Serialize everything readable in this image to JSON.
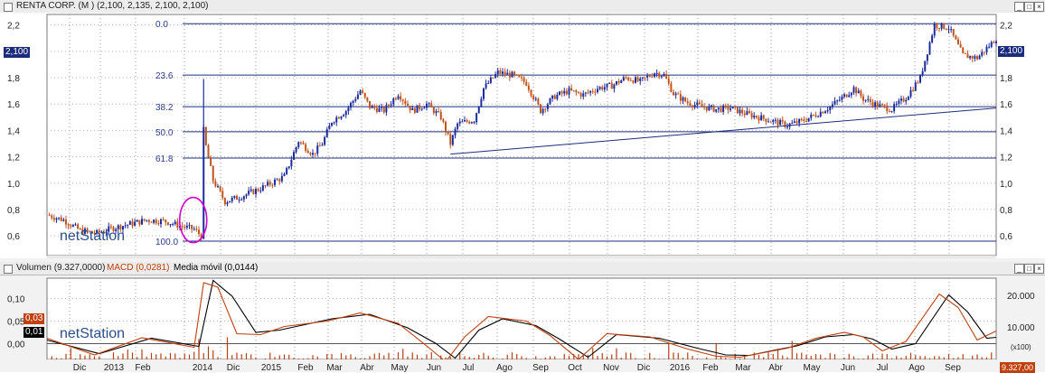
{
  "top_panel": {
    "title": "RENTA CORP. (M ) (2,100, 2,135, 2,100, 2,100)",
    "price_tag": "2,100",
    "watermark": "netStation"
  },
  "bottom_panel": {
    "title_volume": "Volumen (9.327,0000)",
    "title_macd": "MACD (0,0281)",
    "title_ma": "Media móvil (0,0144)",
    "tag_macd": "0,03",
    "tag_ma": "0,01",
    "right_tag": "9.327,00",
    "right_small": "(x100)",
    "watermark": "netStation"
  },
  "buttons": {
    "min": "_",
    "max": "□",
    "close": "×"
  },
  "colors": {
    "up": "#1c2c9c",
    "down": "#c0541c",
    "fib": "#1c2c7c",
    "ellipse": "#d000d0",
    "macd": "#c0400c",
    "signal": "#000000",
    "volume": "#b84010"
  },
  "chart_data": [
    {
      "type": "candlestick",
      "title": "RENTA CORP. (M ) (2,100, 2,135, 2,100, 2,100)",
      "x_labels": [
        "Dic",
        "2013",
        "Feb",
        "2014",
        "Dic",
        "2015",
        "Feb",
        "Mar",
        "Abr",
        "May",
        "Jun",
        "Jul",
        "Ago",
        "Sep",
        "Oct",
        "Nov",
        "Dic",
        "2016",
        "Feb",
        "Mar",
        "Abr",
        "May",
        "Jun",
        "Jul",
        "Ago",
        "Sep"
      ],
      "y_ticks": [
        "0,6",
        "0,8",
        "1,0",
        "1,2",
        "1,4",
        "1,6",
        "1,8",
        "2,0",
        "2,2"
      ],
      "ylim": [
        0.45,
        2.28
      ],
      "last_value": 2.1,
      "fibonacci": [
        {
          "label": "0.0",
          "value": 2.21
        },
        {
          "label": "23.6",
          "value": 1.82
        },
        {
          "label": "38.2",
          "value": 1.58
        },
        {
          "label": "50.0",
          "value": 1.39
        },
        {
          "label": "61.8",
          "value": 1.19
        },
        {
          "label": "100.0",
          "value": 0.56
        }
      ],
      "price_path": [
        [
          0,
          0.76
        ],
        [
          7,
          0.72
        ],
        [
          14,
          0.64
        ],
        [
          21,
          0.62
        ],
        [
          28,
          0.66
        ],
        [
          35,
          0.69
        ],
        [
          42,
          0.72
        ],
        [
          50,
          0.71
        ],
        [
          57,
          0.67
        ],
        [
          62,
          0.65
        ],
        [
          65,
          0.6
        ],
        [
          66,
          1.4
        ],
        [
          67,
          1.28
        ],
        [
          70,
          1.02
        ],
        [
          75,
          0.86
        ],
        [
          82,
          0.9
        ],
        [
          90,
          0.96
        ],
        [
          100,
          1.05
        ],
        [
          106,
          1.32
        ],
        [
          112,
          1.22
        ],
        [
          116,
          1.3
        ],
        [
          120,
          1.47
        ],
        [
          126,
          1.55
        ],
        [
          132,
          1.7
        ],
        [
          136,
          1.58
        ],
        [
          142,
          1.55
        ],
        [
          148,
          1.68
        ],
        [
          154,
          1.55
        ],
        [
          160,
          1.6
        ],
        [
          166,
          1.5
        ],
        [
          170,
          1.3
        ],
        [
          173,
          1.45
        ],
        [
          180,
          1.48
        ],
        [
          184,
          1.72
        ],
        [
          190,
          1.84
        ],
        [
          196,
          1.82
        ],
        [
          202,
          1.76
        ],
        [
          208,
          1.55
        ],
        [
          214,
          1.66
        ],
        [
          220,
          1.7
        ],
        [
          226,
          1.67
        ],
        [
          232,
          1.72
        ],
        [
          238,
          1.74
        ],
        [
          244,
          1.8
        ],
        [
          250,
          1.77
        ],
        [
          256,
          1.84
        ],
        [
          260,
          1.82
        ],
        [
          264,
          1.68
        ],
        [
          270,
          1.61
        ],
        [
          276,
          1.58
        ],
        [
          282,
          1.56
        ],
        [
          288,
          1.57
        ],
        [
          294,
          1.53
        ],
        [
          300,
          1.5
        ],
        [
          306,
          1.47
        ],
        [
          312,
          1.44
        ],
        [
          318,
          1.47
        ],
        [
          324,
          1.52
        ],
        [
          330,
          1.58
        ],
        [
          336,
          1.66
        ],
        [
          340,
          1.72
        ],
        [
          344,
          1.64
        ],
        [
          350,
          1.59
        ],
        [
          356,
          1.56
        ],
        [
          362,
          1.65
        ],
        [
          368,
          1.8
        ],
        [
          374,
          2.2
        ],
        [
          380,
          2.18
        ],
        [
          386,
          1.97
        ],
        [
          392,
          1.95
        ],
        [
          398,
          2.06
        ],
        [
          400,
          2.1
        ]
      ],
      "trendline": [
        [
          170,
          1.22
        ],
        [
          400,
          1.57
        ]
      ],
      "annotation_ellipse_x": 62
    },
    {
      "type": "macd",
      "series": [
        {
          "name": "MACD (0,0281)",
          "points": [
            [
              0,
              0.012
            ],
            [
              20,
              -0.025
            ],
            [
              40,
              0.013
            ],
            [
              62,
              -0.008
            ],
            [
              66,
              0.135
            ],
            [
              72,
              0.125
            ],
            [
              80,
              0.022
            ],
            [
              90,
              0.02
            ],
            [
              100,
              0.038
            ],
            [
              118,
              0.05
            ],
            [
              132,
              0.068
            ],
            [
              148,
              0.045
            ],
            [
              160,
              -0.005
            ],
            [
              168,
              -0.04
            ],
            [
              176,
              0.015
            ],
            [
              186,
              0.06
            ],
            [
              202,
              0.05
            ],
            [
              212,
              0.018
            ],
            [
              224,
              -0.035
            ],
            [
              236,
              0.022
            ],
            [
              254,
              0.015
            ],
            [
              270,
              -0.012
            ],
            [
              282,
              -0.028
            ],
            [
              292,
              -0.03
            ],
            [
              302,
              -0.02
            ],
            [
              312,
              -0.01
            ],
            [
              324,
              0.012
            ],
            [
              336,
              0.025
            ],
            [
              344,
              0.015
            ],
            [
              352,
              -0.016
            ],
            [
              362,
              0.005
            ],
            [
              376,
              0.11
            ],
            [
              384,
              0.08
            ],
            [
              392,
              0.008
            ],
            [
              400,
              0.028
            ]
          ]
        },
        {
          "name": "Media móvil (0,0144)",
          "points": [
            [
              0,
              0.008
            ],
            [
              22,
              -0.022
            ],
            [
              44,
              0.012
            ],
            [
              64,
              -0.006
            ],
            [
              70,
              0.14
            ],
            [
              78,
              0.105
            ],
            [
              88,
              0.025
            ],
            [
              98,
              0.03
            ],
            [
              120,
              0.055
            ],
            [
              136,
              0.065
            ],
            [
              152,
              0.035
            ],
            [
              164,
              0.0
            ],
            [
              172,
              -0.032
            ],
            [
              182,
              0.03
            ],
            [
              192,
              0.055
            ],
            [
              206,
              0.04
            ],
            [
              216,
              0.01
            ],
            [
              228,
              -0.03
            ],
            [
              240,
              0.02
            ],
            [
              258,
              0.012
            ],
            [
              274,
              -0.01
            ],
            [
              286,
              -0.025
            ],
            [
              296,
              -0.026
            ],
            [
              306,
              -0.015
            ],
            [
              316,
              -0.005
            ],
            [
              328,
              0.015
            ],
            [
              340,
              0.02
            ],
            [
              348,
              0.01
            ],
            [
              356,
              -0.012
            ],
            [
              366,
              0.0
            ],
            [
              380,
              0.108
            ],
            [
              388,
              0.07
            ],
            [
              396,
              0.012
            ],
            [
              400,
              0.014
            ]
          ]
        }
      ],
      "ylim": [
        -0.035,
        0.145
      ],
      "y_ticks_left": [
        "0,10",
        "0,05",
        "0,00"
      ],
      "y_ticks_right": [
        "20.000",
        "10.000"
      ],
      "volume_last": 9327
    }
  ]
}
